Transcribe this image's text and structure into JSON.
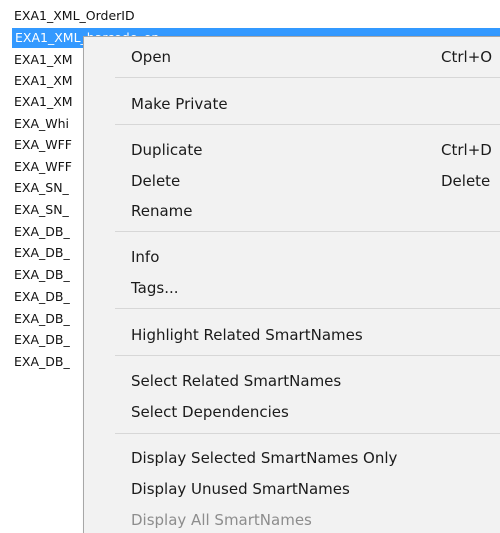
{
  "list": {
    "items": [
      "EXA1_XML_OrderID",
      "EXA1_XML_barcode_en",
      "EXA1_XM",
      "EXA1_XM",
      "EXA1_XM",
      "EXA_Whi",
      "EXA_WFF",
      "EXA_WFF",
      "EXA_SN_",
      "EXA_SN_",
      "EXA_DB_",
      "EXA_DB_",
      "EXA_DB_",
      "EXA_DB_",
      "EXA_DB_",
      "EXA_DB_",
      "EXA_DB_"
    ],
    "selected_index": 1
  },
  "menu": {
    "open": {
      "label": "Open",
      "shortcut": "Ctrl+O"
    },
    "make_private": {
      "label": "Make Private"
    },
    "duplicate": {
      "label": "Duplicate",
      "shortcut": "Ctrl+D"
    },
    "delete": {
      "label": "Delete",
      "shortcut": "Delete"
    },
    "rename": {
      "label": "Rename"
    },
    "info": {
      "label": "Info"
    },
    "tags": {
      "label": "Tags..."
    },
    "highlight_related": {
      "label": "Highlight Related SmartNames"
    },
    "select_related": {
      "label": "Select Related SmartNames"
    },
    "select_dependencies": {
      "label": "Select Dependencies"
    },
    "display_selected_only": {
      "label": "Display Selected SmartNames Only"
    },
    "display_unused": {
      "label": "Display Unused SmartNames"
    },
    "display_all": {
      "label": "Display All SmartNames",
      "enabled": false
    }
  }
}
